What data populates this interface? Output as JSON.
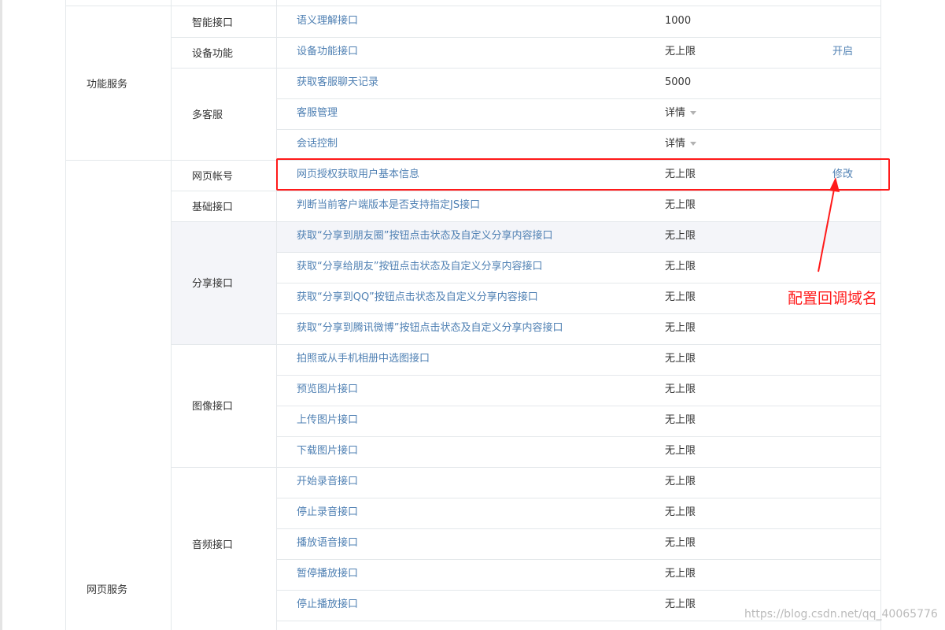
{
  "categories": [
    {
      "label": "功能服务"
    },
    {
      "label": "网页服务"
    }
  ],
  "groups": [
    {
      "label": "智能接口"
    },
    {
      "label": "设备功能"
    },
    {
      "label": "多客服"
    },
    {
      "label": "网页帐号"
    },
    {
      "label": "基础接口"
    },
    {
      "label": "分享接口"
    },
    {
      "label": "图像接口"
    },
    {
      "label": "音频接口"
    }
  ],
  "rows": [
    {
      "name": "语义理解接口",
      "quota": "1000",
      "action": ""
    },
    {
      "name": "设备功能接口",
      "quota": "无上限",
      "action": "开启"
    },
    {
      "name": "获取客服聊天记录",
      "quota": "5000",
      "action": ""
    },
    {
      "name": "客服管理",
      "quota": "详情",
      "action": ""
    },
    {
      "name": "会话控制",
      "quota": "详情",
      "action": ""
    },
    {
      "name": "网页授权获取用户基本信息",
      "quota": "无上限",
      "action": "修改"
    },
    {
      "name": "判断当前客户端版本是否支持指定JS接口",
      "quota": "无上限",
      "action": ""
    },
    {
      "name": "获取“分享到朋友圈”按钮点击状态及自定义分享内容接口",
      "quota": "无上限",
      "action": ""
    },
    {
      "name": "获取“分享给朋友”按钮点击状态及自定义分享内容接口",
      "quota": "无上限",
      "action": ""
    },
    {
      "name": "获取“分享到QQ”按钮点击状态及自定义分享内容接口",
      "quota": "无上限",
      "action": ""
    },
    {
      "name": "获取“分享到腾讯微博”按钮点击状态及自定义分享内容接口",
      "quota": "无上限",
      "action": ""
    },
    {
      "name": "拍照或从手机相册中选图接口",
      "quota": "无上限",
      "action": ""
    },
    {
      "name": "预览图片接口",
      "quota": "无上限",
      "action": ""
    },
    {
      "name": "上传图片接口",
      "quota": "无上限",
      "action": ""
    },
    {
      "name": "下载图片接口",
      "quota": "无上限",
      "action": ""
    },
    {
      "name": "开始录音接口",
      "quota": "无上限",
      "action": ""
    },
    {
      "name": "停止录音接口",
      "quota": "无上限",
      "action": ""
    },
    {
      "name": "播放语音接口",
      "quota": "无上限",
      "action": ""
    },
    {
      "name": "暂停播放接口",
      "quota": "无上限",
      "action": ""
    },
    {
      "name": "停止播放接口",
      "quota": "无上限",
      "action": ""
    }
  ],
  "annotation": {
    "text": "配置回调域名"
  },
  "watermark": {
    "text": "https://blog.csdn.net/qq_40065776"
  },
  "colors": {
    "link": "#4f80b3",
    "annotation": "#ff1a1a",
    "row_highlight": "#f4f5f9"
  },
  "icons": {
    "dropdown": "caret-down-icon",
    "annotation_arrow": "arrow-up-icon"
  }
}
